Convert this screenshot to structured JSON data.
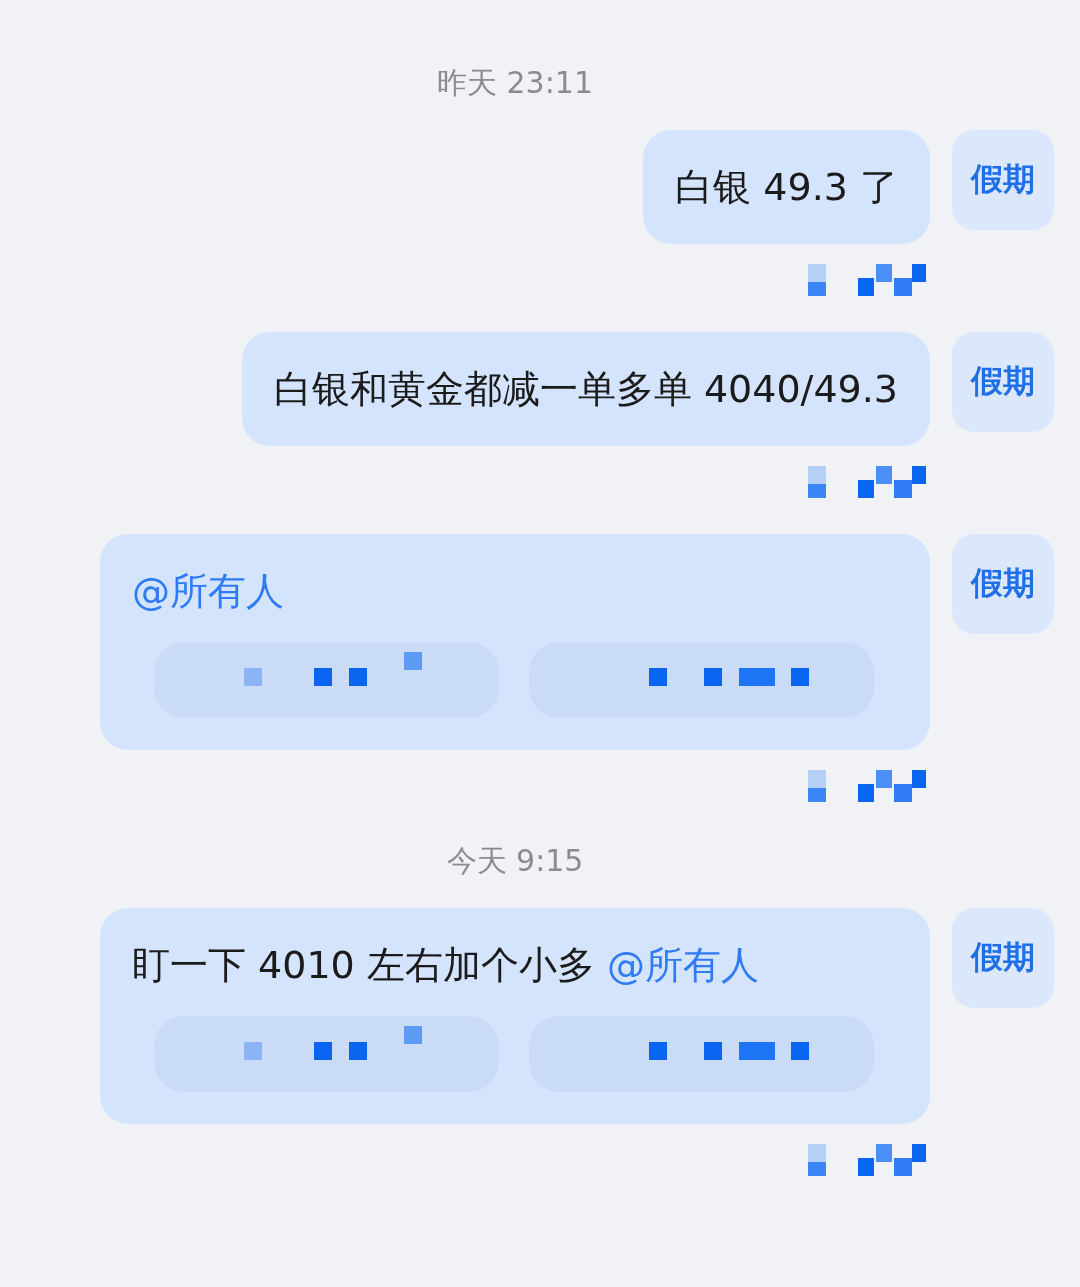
{
  "chat": [
    {
      "kind": "time",
      "text": "昨天 23:11"
    },
    {
      "kind": "message",
      "avatar": "假期",
      "parts": [
        {
          "kind": "text",
          "text": "白银 49.3 了"
        }
      ],
      "obscured_buttons": false
    },
    {
      "kind": "message",
      "avatar": "假期",
      "parts": [
        {
          "kind": "text",
          "text": "白银和黄金都减一单多单 4040/49.3"
        }
      ],
      "obscured_buttons": false
    },
    {
      "kind": "message",
      "avatar": "假期",
      "parts": [
        {
          "kind": "mention",
          "text": "@所有人"
        }
      ],
      "obscured_buttons": true
    },
    {
      "kind": "time",
      "text": "今天 9:15"
    },
    {
      "kind": "message",
      "avatar": "假期",
      "parts": [
        {
          "kind": "text",
          "text": "盯一下 4010 左右加个小多 "
        },
        {
          "kind": "mention",
          "text": "@所有人"
        }
      ],
      "obscured_buttons": true
    }
  ]
}
